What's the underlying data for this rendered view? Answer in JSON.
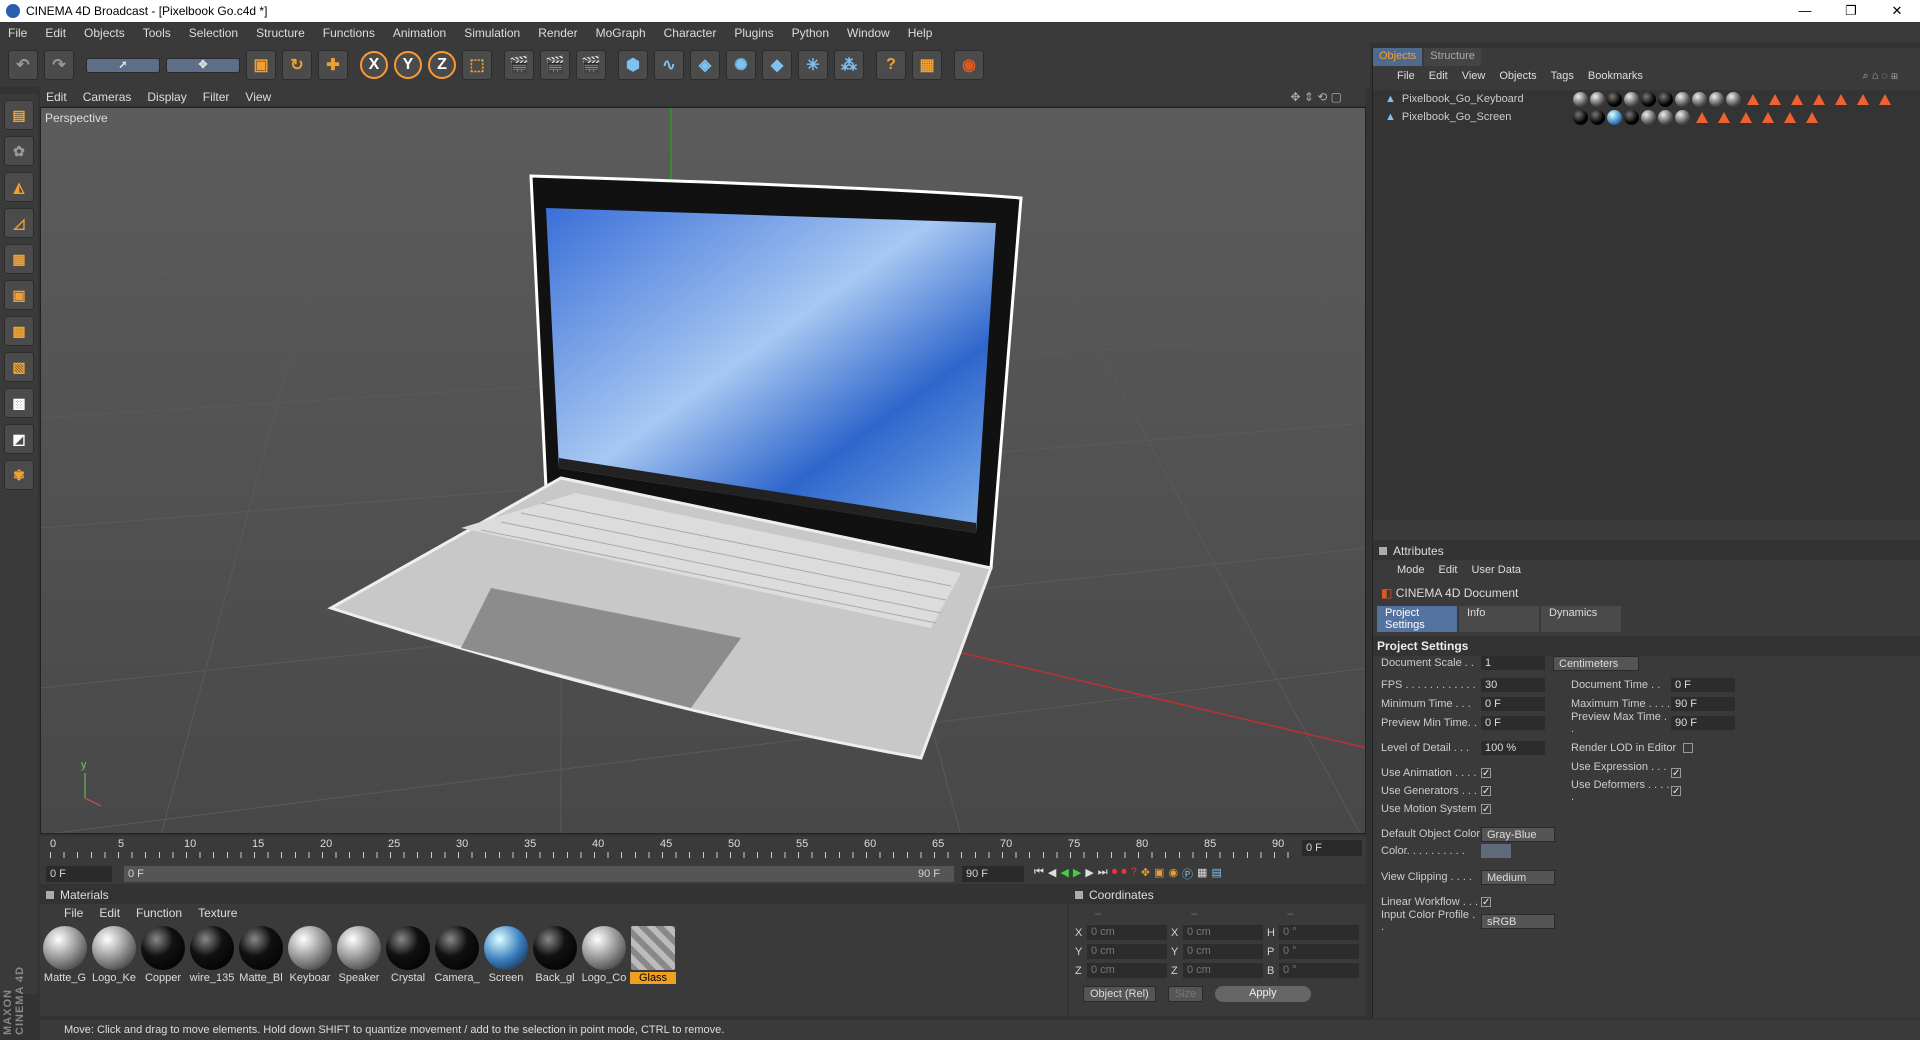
{
  "window": {
    "title": "CINEMA 4D Broadcast - [Pixelbook Go.c4d *]",
    "min": "—",
    "max": "❐",
    "close": "✕"
  },
  "menubar": [
    "File",
    "Edit",
    "Objects",
    "Tools",
    "Selection",
    "Structure",
    "Functions",
    "Animation",
    "Simulation",
    "Render",
    "MoGraph",
    "Character",
    "Plugins",
    "Python",
    "Window",
    "Help"
  ],
  "viewport": {
    "menu": [
      "Edit",
      "Cameras",
      "Display",
      "Filter",
      "View"
    ],
    "label": "Perspective"
  },
  "timeline": {
    "ticks": [
      "0",
      "5",
      "10",
      "15",
      "20",
      "25",
      "30",
      "35",
      "40",
      "45",
      "50",
      "55",
      "60",
      "65",
      "70",
      "75",
      "80",
      "85",
      "90"
    ],
    "frame_end": "0 F",
    "start": "0 F",
    "range_start": "0 F",
    "range_end": "90 F",
    "end": "90 F"
  },
  "materials": {
    "title": "Materials",
    "menu": [
      "File",
      "Edit",
      "Function",
      "Texture"
    ],
    "items": [
      {
        "name": "Matte_G",
        "kind": "grey"
      },
      {
        "name": "Logo_Ke",
        "kind": "grey"
      },
      {
        "name": "Copper",
        "kind": "black"
      },
      {
        "name": "wire_135",
        "kind": "black"
      },
      {
        "name": "Matte_Bl",
        "kind": "black"
      },
      {
        "name": "Keyboar",
        "kind": "grey"
      },
      {
        "name": "Speaker",
        "kind": "grey"
      },
      {
        "name": "Crystal",
        "kind": "black"
      },
      {
        "name": "Camera_",
        "kind": "black"
      },
      {
        "name": "Screen",
        "kind": "blue"
      },
      {
        "name": "Back_gl",
        "kind": "black"
      },
      {
        "name": "Logo_Co",
        "kind": "grey"
      },
      {
        "name": "Glass",
        "kind": "glass"
      }
    ]
  },
  "coordinates": {
    "title": "Coordinates",
    "pos_label": "–",
    "rows": [
      {
        "a": "X",
        "av": "0 cm",
        "b": "X",
        "bv": "0 cm",
        "c": "H",
        "cv": "0 °"
      },
      {
        "a": "Y",
        "av": "0 cm",
        "b": "Y",
        "bv": "0 cm",
        "c": "P",
        "cv": "0 °"
      },
      {
        "a": "Z",
        "av": "0 cm",
        "b": "Z",
        "bv": "0 cm",
        "c": "B",
        "cv": "0 °"
      }
    ],
    "mode": "Object (Rel)",
    "size": "Size",
    "apply": "Apply"
  },
  "status": "Move: Click and drag to move elements. Hold down SHIFT to quantize movement / add to the selection in point mode, CTRL to remove.",
  "objects_panel": {
    "tabs": [
      "Objects",
      "Structure"
    ],
    "menu": [
      "File",
      "Edit",
      "View",
      "Objects",
      "Tags",
      "Bookmarks"
    ],
    "items": [
      "Pixelbook_Go_Keyboard",
      "Pixelbook_Go_Screen"
    ]
  },
  "attributes": {
    "title": "Attributes",
    "menu": [
      "Mode",
      "Edit",
      "User Data"
    ],
    "doc": "CINEMA 4D Document",
    "tabs": [
      "Project Settings",
      "Info",
      "Dynamics"
    ],
    "section": "Project Settings",
    "doc_scale_label": "Document Scale . .",
    "doc_scale": "1",
    "units": "Centimeters",
    "fps_label": "FPS . . . . . . . . . . . .",
    "fps": "30",
    "doc_time_label": "Document Time . .",
    "doc_time": "0 F",
    "min_time_label": "Minimum Time . . .",
    "min_time": "0 F",
    "max_time_label": "Maximum Time . . . .",
    "max_time": "90 F",
    "prev_min_label": "Preview Min Time. .",
    "prev_min": "0 F",
    "prev_max_label": "Preview Max Time . .",
    "prev_max": "90 F",
    "lod_label": "Level of Detail . . .",
    "lod": "100 %",
    "render_lod_label": "Render LOD in Editor",
    "use_anim_label": "Use Animation . . . .",
    "use_expr_label": "Use Expression . . . .",
    "use_gen_label": "Use Generators . . .",
    "use_def_label": "Use Deformers . . . . .",
    "use_motion_label": "Use Motion System",
    "def_color_label": "Default Object Color",
    "def_color": "Gray-Blue",
    "color_label": "Color. . . . . . . . . .",
    "clip_label": "View Clipping . . . .",
    "clip": "Medium",
    "linear_label": "Linear Workflow . . .",
    "profile_label": "Input Color Profile . .",
    "profile": "sRGB"
  },
  "colors": {
    "accent": "#f0a030",
    "selected_tab": "#5472a0"
  }
}
